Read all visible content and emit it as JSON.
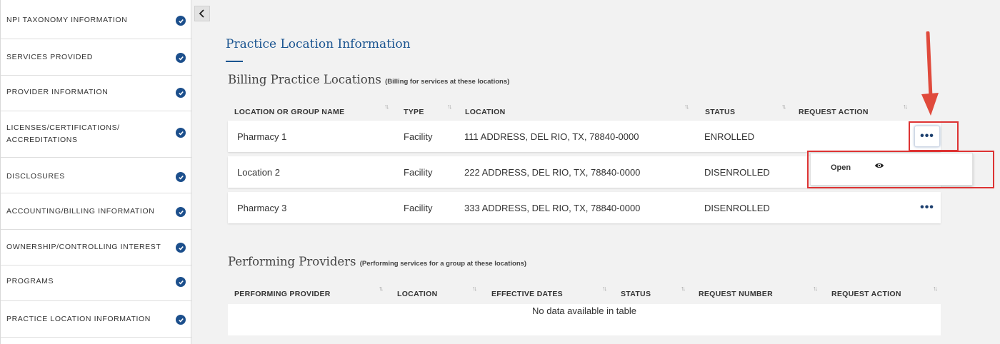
{
  "sidebar": {
    "items": [
      {
        "label": "NPI TAXONOMY INFORMATION"
      },
      {
        "label": "SERVICES PROVIDED"
      },
      {
        "label": "PROVIDER INFORMATION"
      },
      {
        "label": "LICENSES/CERTIFICATIONS/"
      },
      {
        "label": "ACCREDITATIONS"
      },
      {
        "label": "DISCLOSURES"
      },
      {
        "label": "ACCOUNTING/BILLING INFORMATION"
      },
      {
        "label": "OWNERSHIP/CONTROLLING INTEREST"
      },
      {
        "label": "PROGRAMS"
      },
      {
        "label": "PRACTICE LOCATION INFORMATION"
      }
    ]
  },
  "collapse_icon": "chevron-left-icon",
  "page_title": "Practice Location Information",
  "billing": {
    "title": "Billing Practice Locations",
    "subtitle": "(Billing for services at these locations)",
    "columns": [
      "LOCATION OR GROUP NAME",
      "TYPE",
      "LOCATION",
      "STATUS",
      "REQUEST ACTION"
    ],
    "rows": [
      {
        "name": "Pharmacy 1",
        "type": "Facility",
        "location": "111 ADDRESS, DEL RIO, TX, 78840-0000",
        "status": "ENROLLED",
        "action": "•••"
      },
      {
        "name": "Location 2",
        "type": "Facility",
        "location": "222 ADDRESS, DEL RIO, TX, 78840-0000",
        "status": "DISENROLLED",
        "action": "•••"
      },
      {
        "name": "Pharmacy 3",
        "type": "Facility",
        "location": "333 ADDRESS, DEL RIO, TX, 78840-0000",
        "status": "DISENROLLED",
        "action": "•••"
      }
    ]
  },
  "dropdown": {
    "open_label": "Open",
    "icon": "eye-icon"
  },
  "performing": {
    "title": "Performing Providers",
    "subtitle": "(Performing services for a group at these locations)",
    "columns": [
      "PERFORMING PROVIDER",
      "LOCATION",
      "EFFECTIVE DATES",
      "STATUS",
      "REQUEST NUMBER",
      "REQUEST ACTION"
    ],
    "empty_text": "No data available in table"
  },
  "colors": {
    "accent": "#1a5490",
    "check": "#1c4f8c",
    "annotation": "#dd3333"
  }
}
